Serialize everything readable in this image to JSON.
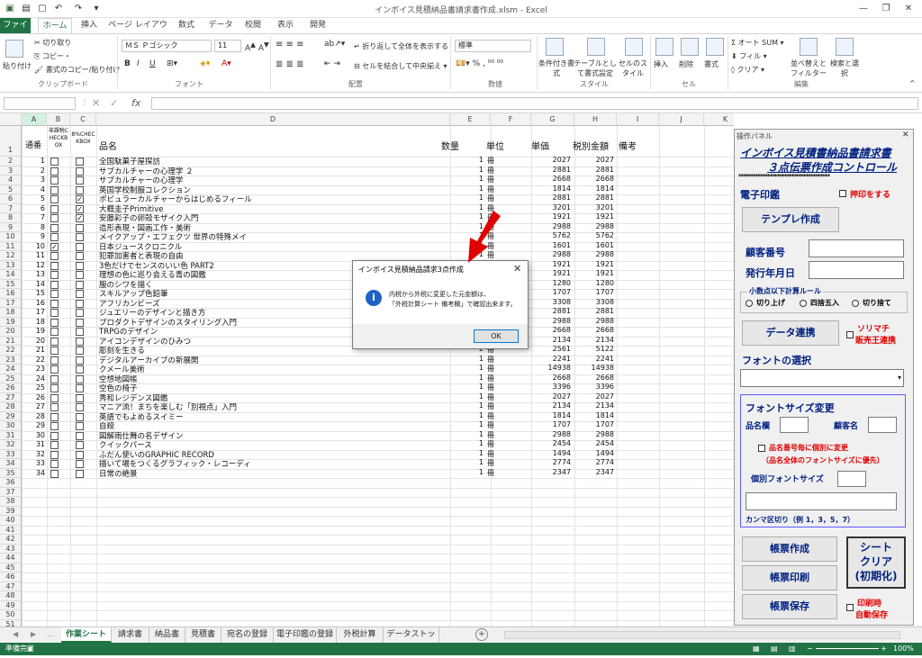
{
  "window": {
    "title": "インボイス見積納品書請求書作成.xlsm - Excel"
  },
  "ribbon_tabs": [
    "ファイル",
    "ホーム",
    "挿入",
    "ページ レイアウト",
    "数式",
    "データ",
    "校閲",
    "表示",
    "開発"
  ],
  "ribbon": {
    "clipboard": {
      "paste": "貼り付け",
      "cut": "切り取り",
      "copy": "コピー・",
      "format_painter": "書式のコピー/貼り付け",
      "group": "クリップボード"
    },
    "font": {
      "name": "ＭＳ Ｐゴシック",
      "size": "11",
      "bold": "B",
      "italic": "I",
      "underline": "U",
      "group": "フォント"
    },
    "align": {
      "wrap": "折り返して全体を表示する",
      "merge": "セルを結合して中央揃え",
      "group": "配置"
    },
    "number": {
      "format": "標準",
      "group": "数値"
    },
    "style": {
      "cond": "条件付き書式",
      "table": "テーブルとして書式設定",
      "cell": "セルのスタイル",
      "group": "スタイル"
    },
    "cells": {
      "insert": "挿入",
      "delete": "削除",
      "format": "書式",
      "group": "セル"
    },
    "edit": {
      "autosum": "オート SUM",
      "fill": "フィル",
      "clear": "クリア",
      "sort": "並べ替えとフィルター",
      "find": "検索と選択",
      "group": "編集"
    }
  },
  "formula_bar": {
    "fx": "fx"
  },
  "columns": [
    "A",
    "B",
    "C",
    "D",
    "E",
    "F",
    "G",
    "H",
    "I",
    "J",
    "K",
    "L",
    "M",
    "N",
    "O"
  ],
  "header_row": {
    "seq": "通番",
    "b": "非課税CHECKBOX",
    "c": "8%CHECKBOX",
    "name": "品名",
    "qty": "数量",
    "unit": "単位",
    "price": "単価",
    "total": "税別金額",
    "note": "備考"
  },
  "rows": [
    {
      "n": 1,
      "name": "全国駄菓子屋探訪",
      "qty": 1,
      "unit": "冊",
      "price": 2027,
      "total": 2027,
      "b": false,
      "c": false
    },
    {
      "n": 2,
      "name": "サブカルチャーの心理学 ２",
      "qty": 1,
      "unit": "冊",
      "price": 2881,
      "total": 2881,
      "b": false,
      "c": false
    },
    {
      "n": 3,
      "name": "サブカルチャーの心理学",
      "qty": 1,
      "unit": "冊",
      "price": 2668,
      "total": 2668,
      "b": false,
      "c": false
    },
    {
      "n": 4,
      "name": "英国学校制服コレクション",
      "qty": 1,
      "unit": "冊",
      "price": 1814,
      "total": 1814,
      "b": false,
      "c": false
    },
    {
      "n": 5,
      "name": "ポピュラーカルチャーからはじめるフィール",
      "qty": 1,
      "unit": "冊",
      "price": 2881,
      "total": 2881,
      "b": false,
      "c": true
    },
    {
      "n": 6,
      "name": "大概圭子Primitive",
      "qty": 1,
      "unit": "冊",
      "price": 3201,
      "total": 3201,
      "b": false,
      "c": true
    },
    {
      "n": 7,
      "name": "安藤彩子の卵殻モザイク入門",
      "qty": 1,
      "unit": "冊",
      "price": 1921,
      "total": 1921,
      "b": false,
      "c": true
    },
    {
      "n": 8,
      "name": "造形表現・図画工作・美術",
      "qty": 1,
      "unit": "冊",
      "price": 2988,
      "total": 2988,
      "b": false,
      "c": false
    },
    {
      "n": 9,
      "name": "メイクアップ・エフェクツ 世界の特殊メイ",
      "qty": 1,
      "unit": "冊",
      "price": 5762,
      "total": 5762,
      "b": false,
      "c": false
    },
    {
      "n": 10,
      "name": "日本ジュースクロニクル",
      "qty": 1,
      "unit": "冊",
      "price": 1601,
      "total": 1601,
      "b": true,
      "c": false
    },
    {
      "n": 11,
      "name": "犯罪加害者と表現の自由",
      "qty": 1,
      "unit": "冊",
      "price": 2988,
      "total": 2988,
      "b": false,
      "c": false
    },
    {
      "n": 12,
      "name": "3色だけでセンスのいい色 PART2",
      "qty": 1,
      "unit": "冊",
      "price": 1921,
      "total": 1921,
      "b": false,
      "c": false
    },
    {
      "n": 13,
      "name": "理想の色に巡り会える青の図鑑",
      "qty": 1,
      "unit": "冊",
      "price": 1921,
      "total": 1921,
      "b": false,
      "c": false
    },
    {
      "n": 14,
      "name": "服のシワを描く",
      "qty": 1,
      "unit": "冊",
      "price": 1280,
      "total": 1280,
      "b": false,
      "c": false
    },
    {
      "n": 15,
      "name": "スキルアップ色鉛筆",
      "qty": 1,
      "unit": "冊",
      "price": 1707,
      "total": 1707,
      "b": false,
      "c": false
    },
    {
      "n": 16,
      "name": "アフリカンビーズ",
      "qty": 1,
      "unit": "冊",
      "price": 3308,
      "total": 3308,
      "b": false,
      "c": false
    },
    {
      "n": 17,
      "name": "ジュエリーのデザインと描き方",
      "qty": 1,
      "unit": "冊",
      "price": 2881,
      "total": 2881,
      "b": false,
      "c": false
    },
    {
      "n": 18,
      "name": "プロダクトデザインのスタイリング入門",
      "qty": 1,
      "unit": "冊",
      "price": 2988,
      "total": 2988,
      "b": false,
      "c": false
    },
    {
      "n": 19,
      "name": "TRPGのデザイン",
      "qty": 1,
      "unit": "冊",
      "price": 2668,
      "total": 2668,
      "b": false,
      "c": false
    },
    {
      "n": 20,
      "name": "アイコンデザインのひみつ",
      "qty": 1,
      "unit": "冊",
      "price": 2134,
      "total": 2134,
      "b": false,
      "c": false
    },
    {
      "n": 21,
      "name": "彫刻を生きる",
      "qty": 2,
      "unit": "冊",
      "price": 2561,
      "total": 5122,
      "b": false,
      "c": false
    },
    {
      "n": 22,
      "name": "デジタルアーカイブの新展開",
      "qty": 1,
      "unit": "冊",
      "price": 2241,
      "total": 2241,
      "b": false,
      "c": false
    },
    {
      "n": 23,
      "name": "クメール美術",
      "qty": 1,
      "unit": "冊",
      "price": 14938,
      "total": 14938,
      "b": false,
      "c": false
    },
    {
      "n": 24,
      "name": "空想地図帳",
      "qty": 1,
      "unit": "冊",
      "price": 2668,
      "total": 2668,
      "b": false,
      "c": false
    },
    {
      "n": 25,
      "name": "空色の椅子",
      "qty": 1,
      "unit": "冊",
      "price": 3396,
      "total": 3396,
      "b": false,
      "c": false
    },
    {
      "n": 26,
      "name": "秀和レジデンス図鑑",
      "qty": 1,
      "unit": "冊",
      "price": 2027,
      "total": 2027,
      "b": false,
      "c": false
    },
    {
      "n": 27,
      "name": "マニア流！まちを楽しむ「別視点」入門",
      "qty": 1,
      "unit": "冊",
      "price": 2134,
      "total": 2134,
      "b": false,
      "c": false
    },
    {
      "n": 28,
      "name": "英語でもよめるスイミー",
      "qty": 1,
      "unit": "冊",
      "price": 1814,
      "total": 1814,
      "b": false,
      "c": false
    },
    {
      "n": 29,
      "name": "自殺",
      "qty": 1,
      "unit": "冊",
      "price": 1707,
      "total": 1707,
      "b": false,
      "c": false
    },
    {
      "n": 30,
      "name": "図解雨仕舞の名デザイン",
      "qty": 1,
      "unit": "冊",
      "price": 2988,
      "total": 2988,
      "b": false,
      "c": false
    },
    {
      "n": 31,
      "name": "クイックパース",
      "qty": 1,
      "unit": "冊",
      "price": 2454,
      "total": 2454,
      "b": false,
      "c": false
    },
    {
      "n": 32,
      "name": "ふだん使いのGRAPHIC RECORD",
      "qty": 1,
      "unit": "冊",
      "price": 1494,
      "total": 1494,
      "b": false,
      "c": false
    },
    {
      "n": 33,
      "name": "描いて場をつくるグラフィック・レコーディ",
      "qty": 1,
      "unit": "冊",
      "price": 2774,
      "total": 2774,
      "b": false,
      "c": false
    },
    {
      "n": 34,
      "name": "日常の絶景",
      "qty": 1,
      "unit": "冊",
      "price": 2347,
      "total": 2347,
      "b": false,
      "c": false
    }
  ],
  "sheet_tabs": [
    "作業シート",
    "請求書",
    "納品書",
    "見積書",
    "宛名の登録",
    "電子印鑑の登録",
    "外税計算",
    "データストック"
  ],
  "status": {
    "left": "準備完了",
    "zoom": "100%"
  },
  "dialog": {
    "title": "インボイス見積納品請求3点作成",
    "line1": "内税から外税に変更した元金額は、",
    "line2": "「外税計算シート 備考欄」で確認出来ます。",
    "ok": "OK"
  },
  "panel": {
    "title": "操作パネル",
    "heading1": "インボイス見積書納品書請求書",
    "heading2": "３点伝票作成コントロール",
    "stars": "**************************************",
    "denshi": "電子印鑑",
    "stamp_check": "押印をする",
    "template_btn": "テンプレ作成",
    "customer_no": "顧客番号",
    "issue_date": "発行年月日",
    "rounding_title": "小数点以下計算ルール",
    "round_up": "切り上げ",
    "round_half": "四捨五入",
    "round_down": "切り捨て",
    "data_btn": "データ連携",
    "sorimachi1": "ソリマチ",
    "sorimachi2": "販売王連携",
    "font_select": "フォントの選択",
    "fontsize_title": "フォントサイズ変更",
    "item_col": "品名欄",
    "cust_name": "顧客名",
    "per_item": "品名番号毎に個別に変更",
    "per_item_note": "（品名全体のフォントサイズに優先）",
    "indiv_size": "個別フォントサイズ",
    "comma_note": "カンマ区切り（例 1，3，5，7）",
    "make_btn": "帳票作成",
    "print_btn": "帳票印刷",
    "save_btn": "帳票保存",
    "clear1": "シート",
    "clear2": "クリア",
    "clear3": "(初期化)",
    "print_save1": "印刷時",
    "print_save2": "自動保存"
  },
  "colors": {
    "excel_green": "#217346",
    "panel_blue": "#002080",
    "red": "#e00000"
  }
}
